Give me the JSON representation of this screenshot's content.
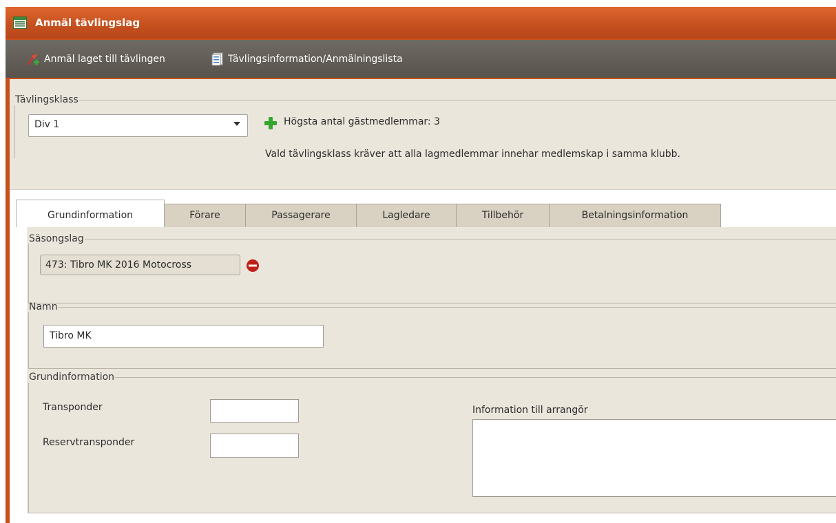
{
  "window": {
    "title": "Anmäl tävlingslag"
  },
  "toolbar": {
    "register_label": "Anmäl laget till tävlingen",
    "info_label": "Tävlingsinformation/Anmälningslista"
  },
  "klass": {
    "legend": "Tävlingsklass",
    "selected": "Div 1",
    "max_guests": "Högsta antal gästmedlemmar: 3",
    "note": "Vald tävlingsklass kräver att alla lagmedlemmar innehar medlemskap i samma klubb."
  },
  "tabs": [
    {
      "label": "Grundinformation",
      "active": true
    },
    {
      "label": "Förare"
    },
    {
      "label": "Passagerare"
    },
    {
      "label": "Lagledare"
    },
    {
      "label": "Tillbehör"
    },
    {
      "label": "Betalningsinformation"
    }
  ],
  "season": {
    "legend": "Säsongslag",
    "team_chip": "473: Tibro MK 2016 Motocross"
  },
  "name": {
    "legend": "Namn",
    "value": "Tibro MK"
  },
  "basic": {
    "legend": "Grundinformation",
    "transponder_label": "Transponder",
    "transponder_value": "",
    "reserve_label": "Reservtransponder",
    "reserve_value": "",
    "organizer_label": "Information till arrangör",
    "organizer_value": ""
  },
  "colors": {
    "titlebar": "#c4501e",
    "toolbar": "#5e5a53",
    "panel": "#ebe6dc",
    "tab_inactive": "#d9d1c2"
  },
  "icons": {
    "title": "list-window-icon",
    "register": "flag-add-icon",
    "info": "document-list-icon",
    "add": "plus-icon",
    "remove": "remove-icon",
    "dropdown": "chevron-down-icon"
  }
}
